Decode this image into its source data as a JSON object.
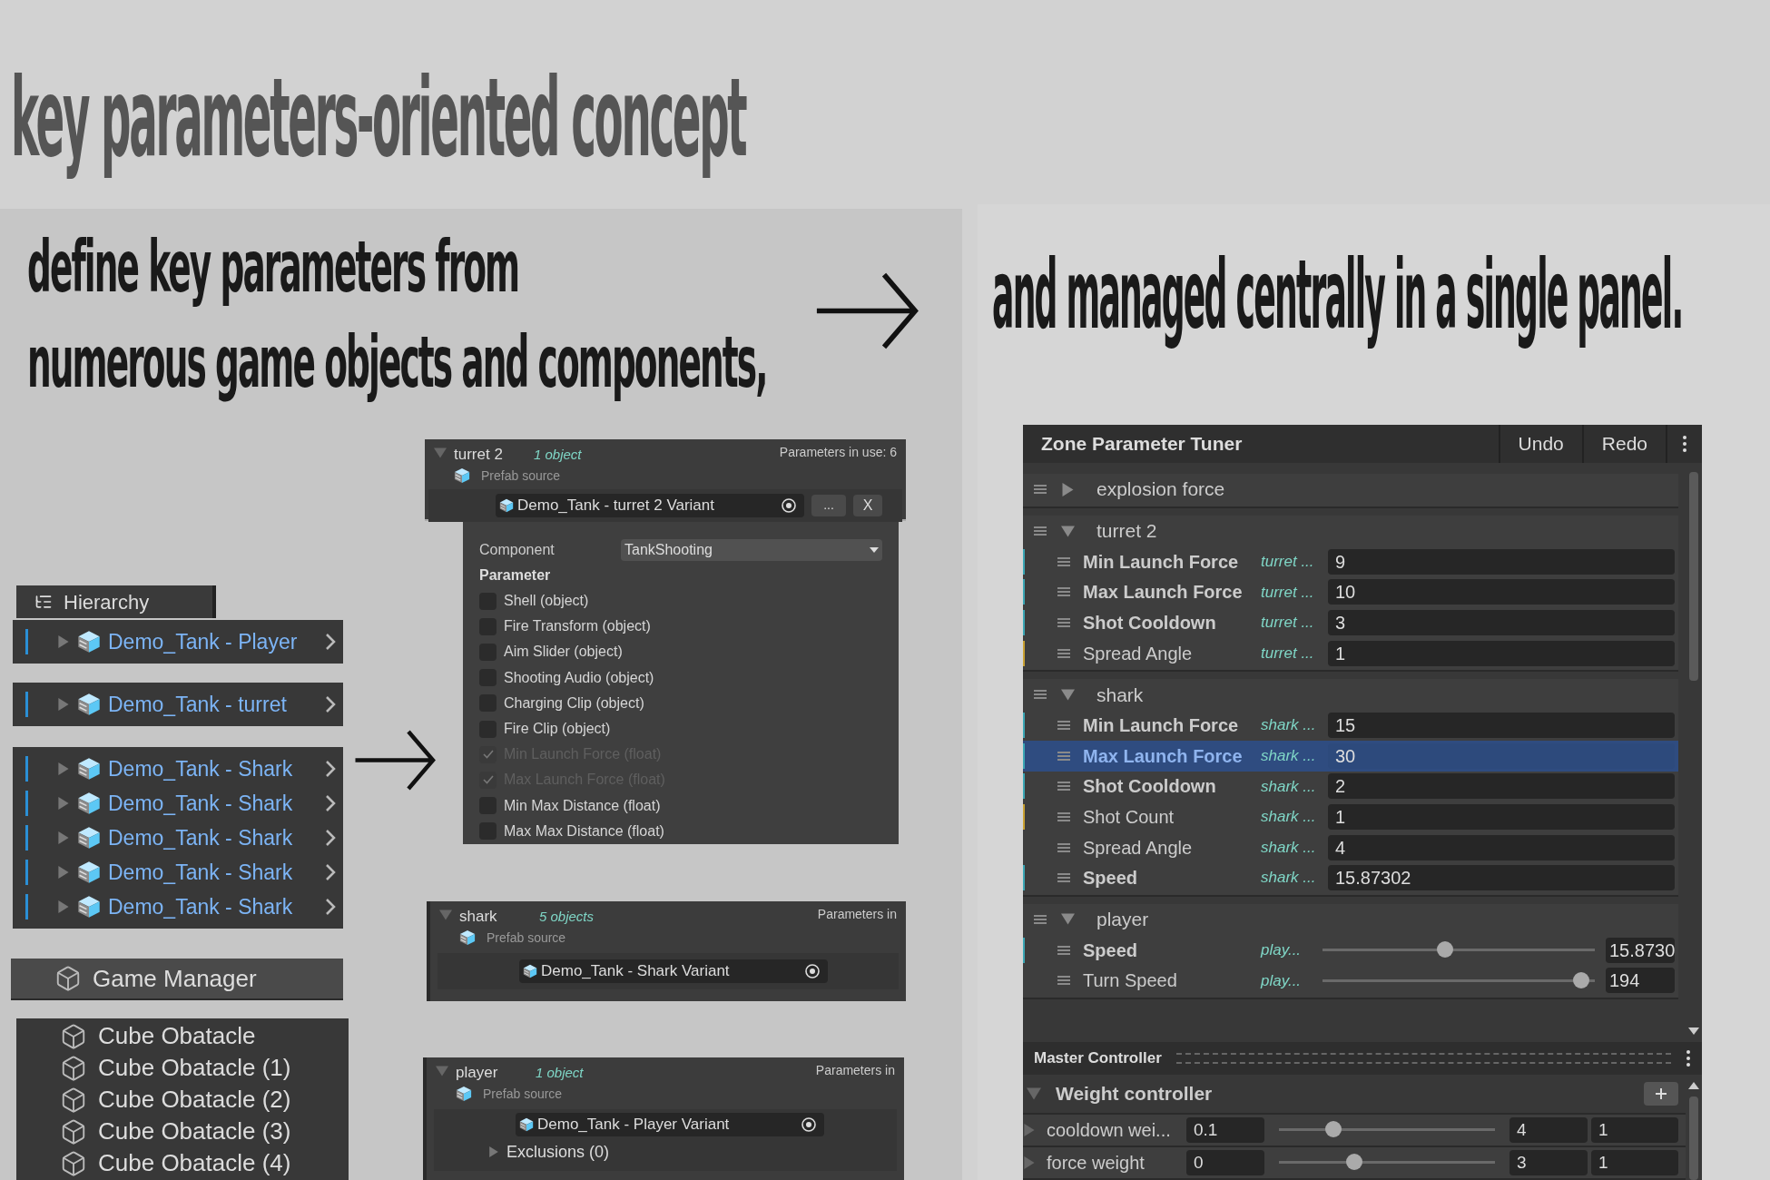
{
  "headline": "key parameters-oriented concept",
  "left_caption": [
    "define key parameters from",
    "numerous game objects and components,"
  ],
  "right_caption": "and managed centrally in a single panel.",
  "hierarchy": {
    "tab": "Hierarchy",
    "groups": [
      {
        "items": [
          "Demo_Tank - Player"
        ]
      },
      {
        "items": [
          "Demo_Tank - turret"
        ]
      },
      {
        "items": [
          "Demo_Tank - Shark",
          "Demo_Tank - Shark",
          "Demo_Tank - Shark",
          "Demo_Tank - Shark",
          "Demo_Tank - Shark"
        ]
      }
    ],
    "game_manager": "Game Manager",
    "obstacles": [
      "Cube Obatacle",
      "Cube Obatacle (1)",
      "Cube Obatacle (2)",
      "Cube Obatacle (3)",
      "Cube Obatacle (4)"
    ]
  },
  "zone_cards": [
    {
      "name": "turret 2",
      "count": "1 object",
      "source_label": "Prefab source",
      "params_in_use": "Parameters in use: 6",
      "prefab": "Demo_Tank - turret 2 Variant",
      "buttons": [
        "...",
        "X"
      ],
      "component_label": "Component",
      "component": "TankShooting",
      "parameter_heading": "Parameter",
      "parameters": [
        {
          "label": "Shell (object)",
          "checked": false
        },
        {
          "label": "Fire Transform (object)",
          "checked": false
        },
        {
          "label": "Aim Slider (object)",
          "checked": false
        },
        {
          "label": "Shooting Audio (object)",
          "checked": false
        },
        {
          "label": "Charging Clip (object)",
          "checked": false
        },
        {
          "label": "Fire Clip (object)",
          "checked": false
        },
        {
          "label": "Min Launch Force (float)",
          "checked": true
        },
        {
          "label": "Max Launch Force (float)",
          "checked": true
        },
        {
          "label": "Min Max Distance (float)",
          "checked": false
        },
        {
          "label": "Max Max Distance (float)",
          "checked": false
        }
      ]
    },
    {
      "name": "shark",
      "count": "5 objects",
      "source_label": "Prefab source",
      "params_in_use": "Parameters in",
      "prefab": "Demo_Tank - Shark Variant"
    },
    {
      "name": "player",
      "count": "1 object",
      "source_label": "Prefab source",
      "params_in_use": "Parameters in",
      "prefab": "Demo_Tank - Player Variant",
      "exclusions": "Exclusions (0)"
    }
  ],
  "tuner": {
    "title": "Zone Parameter Tuner",
    "buttons": [
      "Undo",
      "Redo"
    ],
    "groups": [
      {
        "name": "explosion force",
        "expanded": false
      },
      {
        "name": "turret 2",
        "expanded": true,
        "params": [
          {
            "kind": "field",
            "name": "Min Launch Force",
            "bold": true,
            "color": "#3aa6b4",
            "source": "turret ...",
            "value": "9",
            "selected": false
          },
          {
            "kind": "field",
            "name": "Max Launch Force",
            "bold": true,
            "color": "#3aa6b4",
            "source": "turret ...",
            "value": "10",
            "selected": false
          },
          {
            "kind": "field",
            "name": "Shot Cooldown",
            "bold": true,
            "color": "#3aa6b4",
            "source": "turret ...",
            "value": "3",
            "selected": false
          },
          {
            "kind": "field",
            "name": "Spread Angle",
            "bold": false,
            "color": "#c9a132",
            "source": "turret ...",
            "value": "1",
            "selected": false
          }
        ]
      },
      {
        "name": "shark",
        "expanded": true,
        "params": [
          {
            "kind": "field",
            "name": "Min Launch Force",
            "bold": true,
            "color": "#3aa6b4",
            "source": "shark ...",
            "value": "15",
            "selected": false
          },
          {
            "kind": "field",
            "name": "Max Launch Force",
            "bold": true,
            "color": "#3aa6b4",
            "source": "shark ...",
            "value": "30",
            "selected": true
          },
          {
            "kind": "field",
            "name": "Shot Cooldown",
            "bold": true,
            "color": "#3aa6b4",
            "source": "shark ...",
            "value": "2",
            "selected": false
          },
          {
            "kind": "field",
            "name": "Shot Count",
            "bold": false,
            "color": "#c9a132",
            "source": "shark ...",
            "value": "1",
            "selected": false
          },
          {
            "kind": "field",
            "name": "Spread Angle",
            "bold": false,
            "source": "shark ...",
            "value": "4",
            "selected": false
          },
          {
            "kind": "field",
            "name": "Speed",
            "bold": true,
            "color": "#3aa6b4",
            "source": "shark ...",
            "value": "15.87302",
            "selected": false
          }
        ]
      },
      {
        "name": "player",
        "expanded": true,
        "params": [
          {
            "kind": "slider",
            "name": "Speed",
            "bold": true,
            "color": "#3aa6b4",
            "source": "play...",
            "value": "15.8730",
            "level": 0.45,
            "selected": false
          },
          {
            "kind": "slider",
            "name": "Turn Speed",
            "bold": false,
            "source": "play...",
            "value": "194",
            "level": 0.95,
            "selected": false
          }
        ]
      }
    ]
  },
  "master": {
    "title": "Master Controller",
    "controller": "Weight controller",
    "rows": [
      {
        "name": "cooldown wei...",
        "min": "0.1",
        "level": 0.25,
        "max": "4",
        "value": "1"
      },
      {
        "name": "force weight",
        "min": "0",
        "level": 0.35,
        "max": "3",
        "value": "1"
      }
    ]
  }
}
